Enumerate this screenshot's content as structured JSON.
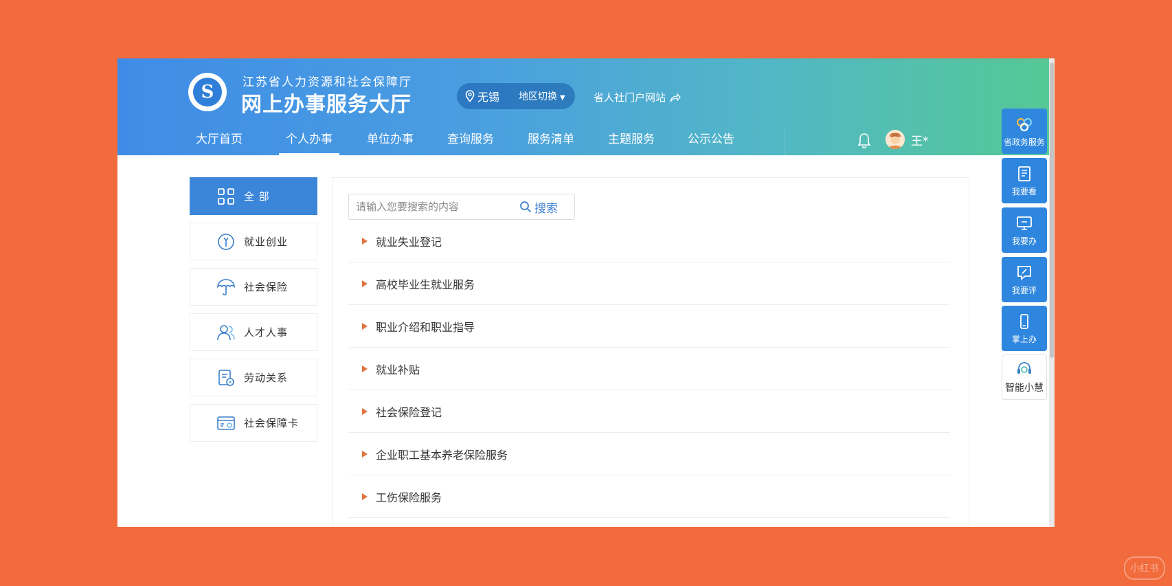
{
  "header": {
    "org_name": "江苏省人力资源和社会保障厅",
    "site_title": "网上办事服务大厅",
    "region": "无锡",
    "region_switch": "地区切换",
    "portal_link": "省人社门户网站"
  },
  "nav": {
    "items": [
      {
        "label": "大厅首页"
      },
      {
        "label": "个人办事",
        "active": true
      },
      {
        "label": "单位办事"
      },
      {
        "label": "查询服务"
      },
      {
        "label": "服务清单"
      },
      {
        "label": "主题服务"
      },
      {
        "label": "公示公告"
      }
    ],
    "user_name": "王*"
  },
  "sidebar": {
    "items": [
      {
        "label": "全 部",
        "icon": "grid-icon",
        "active": true
      },
      {
        "label": "就业创业",
        "icon": "employment-icon"
      },
      {
        "label": "社会保险",
        "icon": "umbrella-icon"
      },
      {
        "label": "人才人事",
        "icon": "people-icon"
      },
      {
        "label": "劳动关系",
        "icon": "document-icon"
      },
      {
        "label": "社会保障卡",
        "icon": "card-icon"
      }
    ]
  },
  "search": {
    "placeholder": "请输入您要搜索的内容",
    "button_label": "搜索"
  },
  "categories": [
    {
      "label": "就业失业登记"
    },
    {
      "label": "高校毕业生就业服务"
    },
    {
      "label": "职业介绍和职业指导"
    },
    {
      "label": "就业补贴"
    },
    {
      "label": "社会保险登记"
    },
    {
      "label": "企业职工基本养老保险服务"
    },
    {
      "label": "工伤保险服务"
    }
  ],
  "float_bar": {
    "items": [
      {
        "label": "省政务服务",
        "icon": "gov-service-icon"
      },
      {
        "label": "我要看",
        "icon": "notebook-icon"
      },
      {
        "label": "我要办",
        "icon": "monitor-icon"
      },
      {
        "label": "我要评",
        "icon": "edit-icon"
      },
      {
        "label": "掌上办",
        "icon": "phone-icon"
      },
      {
        "label": "智能小慧",
        "icon": "headset-icon"
      }
    ]
  },
  "watermark": "小红书",
  "colors": {
    "background": "#f26b3c",
    "primary": "#3b86d8",
    "accent_triangle": "#e0733f"
  }
}
